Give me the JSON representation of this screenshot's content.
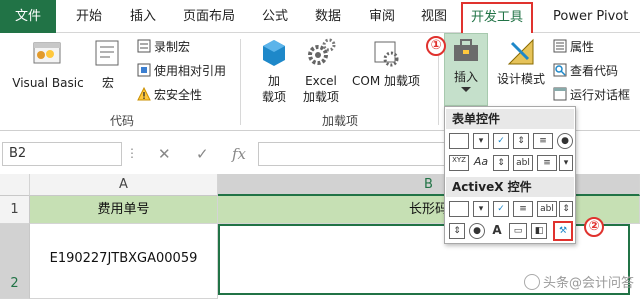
{
  "tabs": {
    "file": "文件",
    "home": "开始",
    "insert": "插入",
    "page_layout": "页面布局",
    "formulas": "公式",
    "data": "数据",
    "review": "审阅",
    "view": "视图",
    "developer": "开发工具",
    "power_pivot": "Power Pivot"
  },
  "ribbon": {
    "code_group": {
      "label": "代码",
      "visual_basic": "Visual Basic",
      "macros": "宏",
      "record_macro": "录制宏",
      "relative_refs": "使用相对引用",
      "macro_security": "宏安全性"
    },
    "addins_group": {
      "label": "加载项",
      "addins_line1": "加",
      "addins_line2": "载项",
      "excel_addins_line1": "Excel",
      "excel_addins_line2": "加载项",
      "com_addins": "COM 加载项"
    },
    "controls_group": {
      "insert": "插入",
      "design_mode": "设计模式",
      "properties": "属性",
      "view_code": "查看代码",
      "run_dialog": "运行对话框"
    }
  },
  "badges": {
    "one": "①",
    "two": "②"
  },
  "dropdown": {
    "form_controls": "表单控件",
    "activex_controls": "ActiveX 控件",
    "text_box_label": "abl",
    "xyz_label": "XYZ",
    "aa_label": "Aa",
    "a_label": "A"
  },
  "formula_bar": {
    "name_box": "B2",
    "cancel": "✕",
    "enter": "✓",
    "fx": "fx"
  },
  "sheet": {
    "col_a": "A",
    "col_b": "B",
    "row_1": "1",
    "row_2": "2",
    "a1": "费用单号",
    "b1": "长形码",
    "a2": "E190227JTBXGA00059"
  },
  "watermark": "头条@会计问答",
  "colors": {
    "excel_green": "#217346",
    "header_fill": "#c6e0b4",
    "highlight_red": "#e0322e"
  }
}
